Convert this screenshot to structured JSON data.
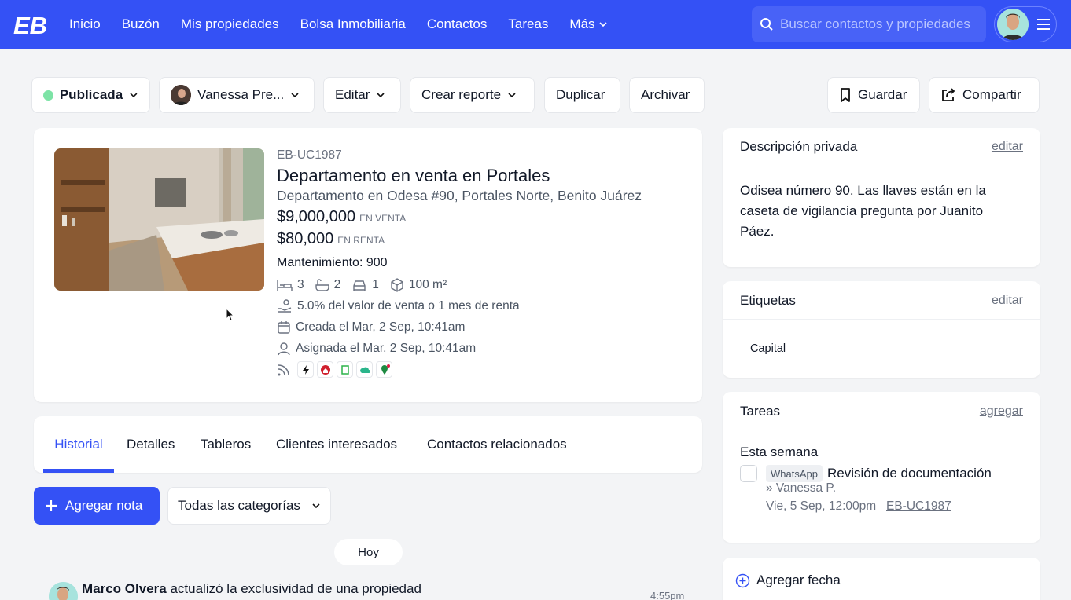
{
  "header": {
    "logo_text": "EB",
    "nav": [
      {
        "label": "Inicio"
      },
      {
        "label": "Buzón"
      },
      {
        "label": "Mis propiedades"
      },
      {
        "label": "Bolsa Inmobiliaria"
      },
      {
        "label": "Contactos"
      },
      {
        "label": "Tareas"
      },
      {
        "label": "Más"
      }
    ],
    "search_placeholder": "Buscar contactos y propiedades"
  },
  "actions": {
    "status": "Publicada",
    "agent": "Vanessa Pre...",
    "edit": "Editar",
    "report": "Crear reporte",
    "duplicate": "Duplicar",
    "archive": "Archivar",
    "save": "Guardar",
    "share": "Compartir"
  },
  "property": {
    "code": "EB-UC1987",
    "title": "Departamento en venta en Portales",
    "address": "Departamento en Odesa #90, Portales Norte, Benito Juárez",
    "sale_price": "$9,000,000",
    "sale_label": "EN VENTA",
    "rent_price": "$80,000",
    "rent_label": "EN RENTA",
    "maintenance": "Mantenimiento: 900",
    "bedrooms": "3",
    "bathrooms": "2",
    "parking": "1",
    "area": "100 m²",
    "commission": "5.0% del valor de venta o 1 mes de renta",
    "created": "Creada el Mar, 2 Sep, 10:41am",
    "assigned": "Asignada el Mar, 2 Sep, 10:41am"
  },
  "tabs": [
    {
      "label": "Historial"
    },
    {
      "label": "Detalles"
    },
    {
      "label": "Tableros"
    },
    {
      "label": "Clientes interesados"
    },
    {
      "label": "Contactos relacionados"
    }
  ],
  "history": {
    "add_note": "Agregar nota",
    "category_filter": "Todas las categorías",
    "day_label": "Hoy",
    "entry_user": "Marco Olvera",
    "entry_text": "actualizó la exclusividad de una propiedad",
    "entry_time": "4:55pm"
  },
  "private_description": {
    "title": "Descripción privada",
    "edit": "editar",
    "text": "Odisea número 90. Las llaves están en la caseta de vigilancia pregunta por Juanito Páez."
  },
  "tags": {
    "title": "Etiquetas",
    "edit": "editar",
    "items": [
      "Capital"
    ]
  },
  "tasks": {
    "title": "Tareas",
    "add": "agregar",
    "group": "Esta semana",
    "item": {
      "badge": "WhatsApp",
      "title": "Revisión de documentación",
      "assignee": "» Vanessa P.",
      "due": "Vie, 5 Sep, 12:00pm",
      "ref": "EB-UC1987"
    }
  },
  "dates": {
    "add_date": "Agregar fecha"
  },
  "colors": {
    "brand": "#3451f5",
    "status_green": "#7de3a6"
  }
}
